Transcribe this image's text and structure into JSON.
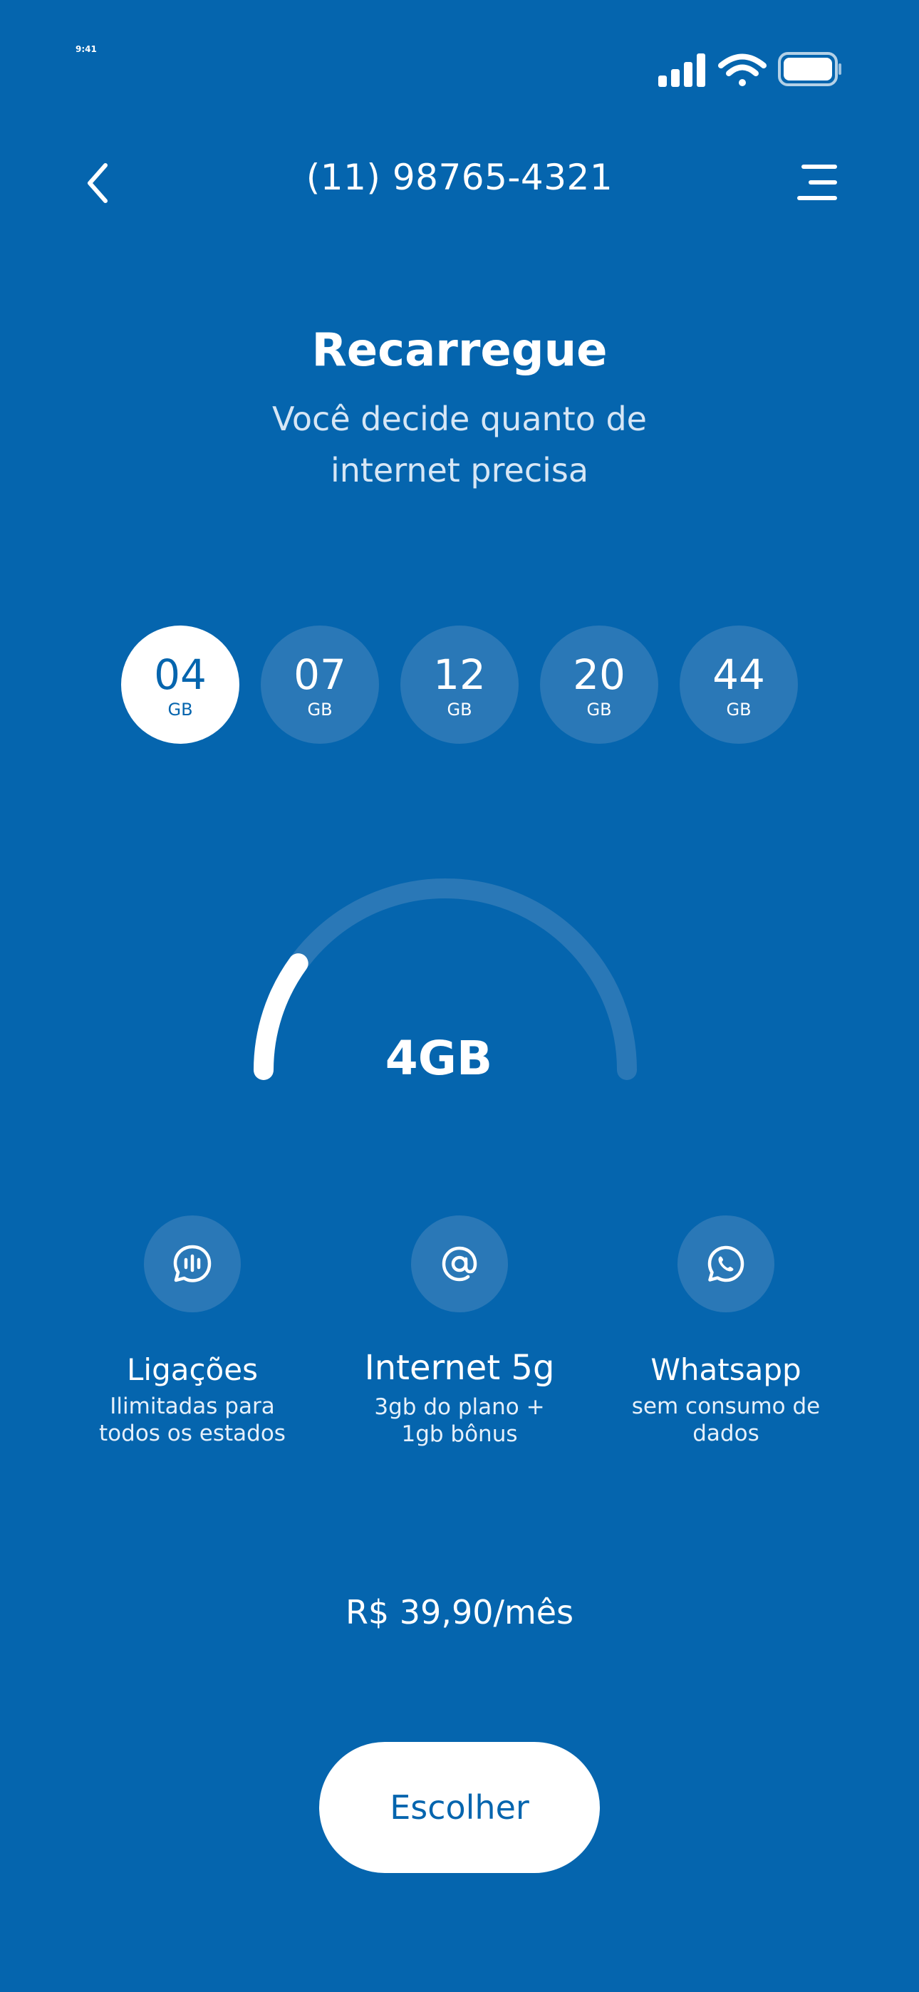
{
  "status_bar": {
    "time": "9:41"
  },
  "header": {
    "phone_number": "(11) 98765-4321"
  },
  "hero": {
    "title": "Recarregue",
    "subtitle": "Você decide quanto de internet precisa"
  },
  "packages": [
    {
      "amount": "04",
      "unit": "GB",
      "selected": true
    },
    {
      "amount": "07",
      "unit": "GB",
      "selected": false
    },
    {
      "amount": "12",
      "unit": "GB",
      "selected": false
    },
    {
      "amount": "20",
      "unit": "GB",
      "selected": false
    },
    {
      "amount": "44",
      "unit": "GB",
      "selected": false
    }
  ],
  "gauge": {
    "value_label": "4GB",
    "fill_fraction": 0.2
  },
  "features": [
    {
      "icon": "chat-bubble-icon",
      "title": "Ligações",
      "description": "Ilimitadas para todos os estados"
    },
    {
      "icon": "at-sign-icon",
      "title": "Internet 5g",
      "description": "3gb do plano + 1gb bônus"
    },
    {
      "icon": "whatsapp-icon",
      "title": "Whatsapp",
      "description": "sem consumo de dados"
    }
  ],
  "price": "R$ 39,90/mês",
  "cta_label": "Escolher",
  "colors": {
    "background": "#0565ae",
    "chip_bg": "#2a78b7",
    "selected_bg": "#ffffff",
    "accent_text": "#0565ae"
  }
}
